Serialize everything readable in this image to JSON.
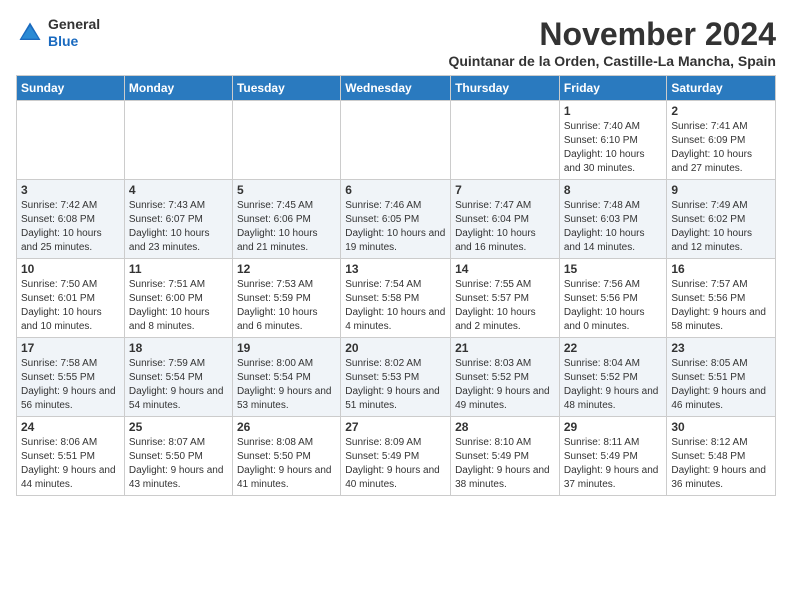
{
  "header": {
    "logo_general": "General",
    "logo_blue": "Blue",
    "month_title": "November 2024",
    "subtitle": "Quintanar de la Orden, Castille-La Mancha, Spain"
  },
  "weekdays": [
    "Sunday",
    "Monday",
    "Tuesday",
    "Wednesday",
    "Thursday",
    "Friday",
    "Saturday"
  ],
  "weeks": [
    [
      {
        "day": "",
        "info": ""
      },
      {
        "day": "",
        "info": ""
      },
      {
        "day": "",
        "info": ""
      },
      {
        "day": "",
        "info": ""
      },
      {
        "day": "",
        "info": ""
      },
      {
        "day": "1",
        "info": "Sunrise: 7:40 AM\nSunset: 6:10 PM\nDaylight: 10 hours and 30 minutes."
      },
      {
        "day": "2",
        "info": "Sunrise: 7:41 AM\nSunset: 6:09 PM\nDaylight: 10 hours and 27 minutes."
      }
    ],
    [
      {
        "day": "3",
        "info": "Sunrise: 7:42 AM\nSunset: 6:08 PM\nDaylight: 10 hours and 25 minutes."
      },
      {
        "day": "4",
        "info": "Sunrise: 7:43 AM\nSunset: 6:07 PM\nDaylight: 10 hours and 23 minutes."
      },
      {
        "day": "5",
        "info": "Sunrise: 7:45 AM\nSunset: 6:06 PM\nDaylight: 10 hours and 21 minutes."
      },
      {
        "day": "6",
        "info": "Sunrise: 7:46 AM\nSunset: 6:05 PM\nDaylight: 10 hours and 19 minutes."
      },
      {
        "day": "7",
        "info": "Sunrise: 7:47 AM\nSunset: 6:04 PM\nDaylight: 10 hours and 16 minutes."
      },
      {
        "day": "8",
        "info": "Sunrise: 7:48 AM\nSunset: 6:03 PM\nDaylight: 10 hours and 14 minutes."
      },
      {
        "day": "9",
        "info": "Sunrise: 7:49 AM\nSunset: 6:02 PM\nDaylight: 10 hours and 12 minutes."
      }
    ],
    [
      {
        "day": "10",
        "info": "Sunrise: 7:50 AM\nSunset: 6:01 PM\nDaylight: 10 hours and 10 minutes."
      },
      {
        "day": "11",
        "info": "Sunrise: 7:51 AM\nSunset: 6:00 PM\nDaylight: 10 hours and 8 minutes."
      },
      {
        "day": "12",
        "info": "Sunrise: 7:53 AM\nSunset: 5:59 PM\nDaylight: 10 hours and 6 minutes."
      },
      {
        "day": "13",
        "info": "Sunrise: 7:54 AM\nSunset: 5:58 PM\nDaylight: 10 hours and 4 minutes."
      },
      {
        "day": "14",
        "info": "Sunrise: 7:55 AM\nSunset: 5:57 PM\nDaylight: 10 hours and 2 minutes."
      },
      {
        "day": "15",
        "info": "Sunrise: 7:56 AM\nSunset: 5:56 PM\nDaylight: 10 hours and 0 minutes."
      },
      {
        "day": "16",
        "info": "Sunrise: 7:57 AM\nSunset: 5:56 PM\nDaylight: 9 hours and 58 minutes."
      }
    ],
    [
      {
        "day": "17",
        "info": "Sunrise: 7:58 AM\nSunset: 5:55 PM\nDaylight: 9 hours and 56 minutes."
      },
      {
        "day": "18",
        "info": "Sunrise: 7:59 AM\nSunset: 5:54 PM\nDaylight: 9 hours and 54 minutes."
      },
      {
        "day": "19",
        "info": "Sunrise: 8:00 AM\nSunset: 5:54 PM\nDaylight: 9 hours and 53 minutes."
      },
      {
        "day": "20",
        "info": "Sunrise: 8:02 AM\nSunset: 5:53 PM\nDaylight: 9 hours and 51 minutes."
      },
      {
        "day": "21",
        "info": "Sunrise: 8:03 AM\nSunset: 5:52 PM\nDaylight: 9 hours and 49 minutes."
      },
      {
        "day": "22",
        "info": "Sunrise: 8:04 AM\nSunset: 5:52 PM\nDaylight: 9 hours and 48 minutes."
      },
      {
        "day": "23",
        "info": "Sunrise: 8:05 AM\nSunset: 5:51 PM\nDaylight: 9 hours and 46 minutes."
      }
    ],
    [
      {
        "day": "24",
        "info": "Sunrise: 8:06 AM\nSunset: 5:51 PM\nDaylight: 9 hours and 44 minutes."
      },
      {
        "day": "25",
        "info": "Sunrise: 8:07 AM\nSunset: 5:50 PM\nDaylight: 9 hours and 43 minutes."
      },
      {
        "day": "26",
        "info": "Sunrise: 8:08 AM\nSunset: 5:50 PM\nDaylight: 9 hours and 41 minutes."
      },
      {
        "day": "27",
        "info": "Sunrise: 8:09 AM\nSunset: 5:49 PM\nDaylight: 9 hours and 40 minutes."
      },
      {
        "day": "28",
        "info": "Sunrise: 8:10 AM\nSunset: 5:49 PM\nDaylight: 9 hours and 38 minutes."
      },
      {
        "day": "29",
        "info": "Sunrise: 8:11 AM\nSunset: 5:49 PM\nDaylight: 9 hours and 37 minutes."
      },
      {
        "day": "30",
        "info": "Sunrise: 8:12 AM\nSunset: 5:48 PM\nDaylight: 9 hours and 36 minutes."
      }
    ]
  ]
}
